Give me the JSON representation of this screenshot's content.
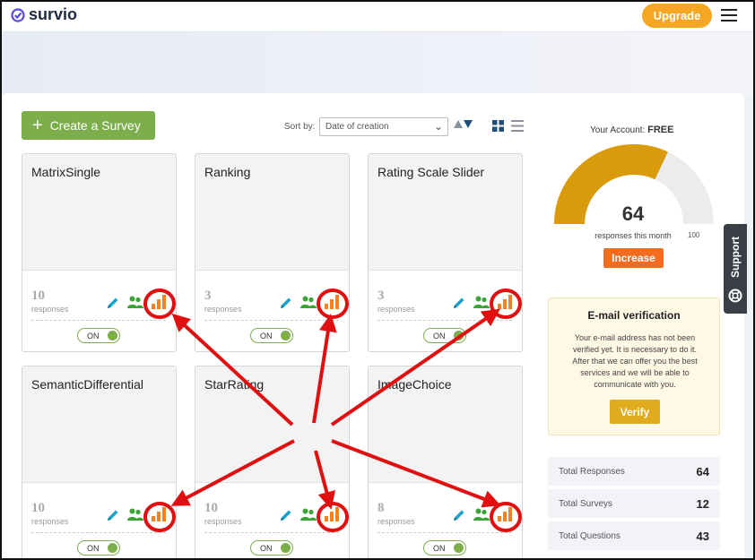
{
  "header": {
    "logo_text": "survio",
    "upgrade_label": "Upgrade"
  },
  "toolbar": {
    "create_label": "Create a Survey",
    "sort_label": "Sort by:",
    "sort_value": "Date of creation"
  },
  "cards": [
    {
      "title": "MatrixSingle",
      "count": "10",
      "responses_label": "responses",
      "toggle": "ON"
    },
    {
      "title": "Ranking",
      "count": "3",
      "responses_label": "responses",
      "toggle": "ON"
    },
    {
      "title": "Rating Scale Slider",
      "count": "3",
      "responses_label": "responses",
      "toggle": "ON"
    },
    {
      "title": "SemanticDifferential",
      "count": "10",
      "responses_label": "responses",
      "toggle": "ON"
    },
    {
      "title": "StarRating",
      "count": "10",
      "responses_label": "responses",
      "toggle": "ON"
    },
    {
      "title": "ImageChoice",
      "count": "8",
      "responses_label": "responses",
      "toggle": "ON"
    }
  ],
  "account": {
    "label": "Your Account:",
    "plan": "FREE",
    "responses": 64,
    "responses_max": 100,
    "value_text": "64",
    "max_text": "100",
    "sub_label": "responses this month",
    "increase_label": "Increase"
  },
  "verification": {
    "title": "E-mail verification",
    "text": "Your e-mail address has not been verified yet. It is necessary to do it. After that we can offer you the best services and we will be able to communicate with you.",
    "button": "Verify"
  },
  "stats": [
    {
      "label": "Total Responses",
      "value": "64"
    },
    {
      "label": "Total Surveys",
      "value": "12"
    },
    {
      "label": "Total Questions",
      "value": "43"
    }
  ],
  "support": {
    "label": "Support"
  },
  "colors": {
    "accent_green": "#7cae4c",
    "upgrade_orange": "#f5a623",
    "gauge_fill": "#d99a0b",
    "gauge_track": "#ececec",
    "increase_orange": "#f36d21",
    "annotation_red": "#e01010"
  }
}
